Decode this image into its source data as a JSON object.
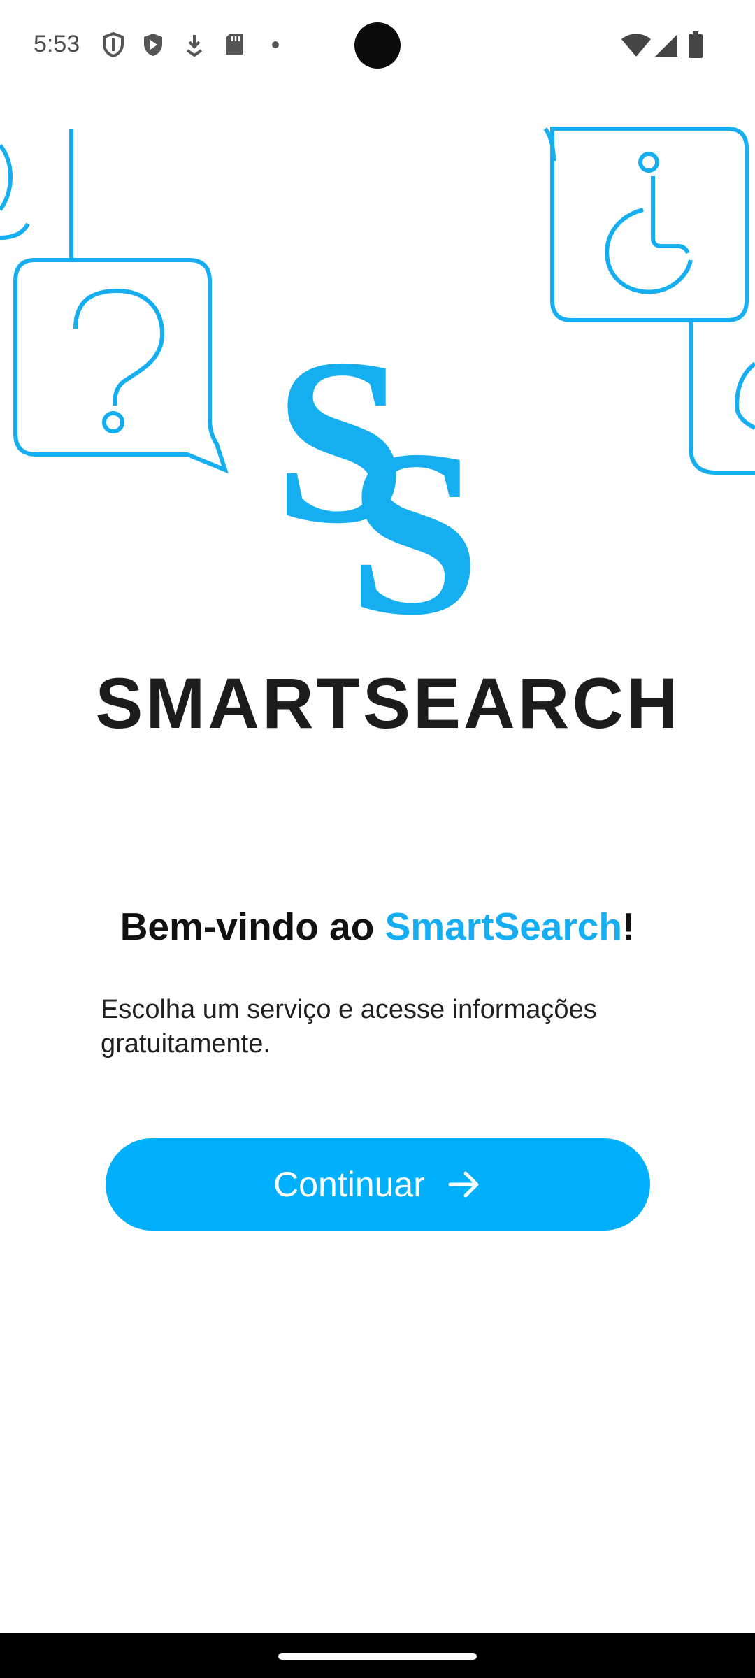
{
  "status_bar": {
    "time": "5:53",
    "left_icons": [
      "shield-outline-icon",
      "play-shield-icon",
      "download-icon",
      "sd-card-icon",
      "dot-icon"
    ],
    "right_icons": [
      "wifi-icon",
      "signal-icon",
      "battery-icon"
    ]
  },
  "hero": {
    "logo_monogram": "SS",
    "logo_wordmark": "SMARTSEARCH",
    "icons": [
      "question-bubble-icon",
      "accessibility-bubble-icon"
    ]
  },
  "welcome": {
    "prefix": "Bem-vindo ao ",
    "brand": "SmartSearch",
    "suffix": "!"
  },
  "subtitle": "Escolha um serviço e acesse informações gratuitamente.",
  "continue_button": {
    "label": "Continuar",
    "icon": "arrow-right-icon"
  },
  "colors": {
    "accent": "#00b0fd",
    "brand_text": "#16aef2",
    "illustration": "#15aef0",
    "wordmark": "#1c1c1c"
  }
}
